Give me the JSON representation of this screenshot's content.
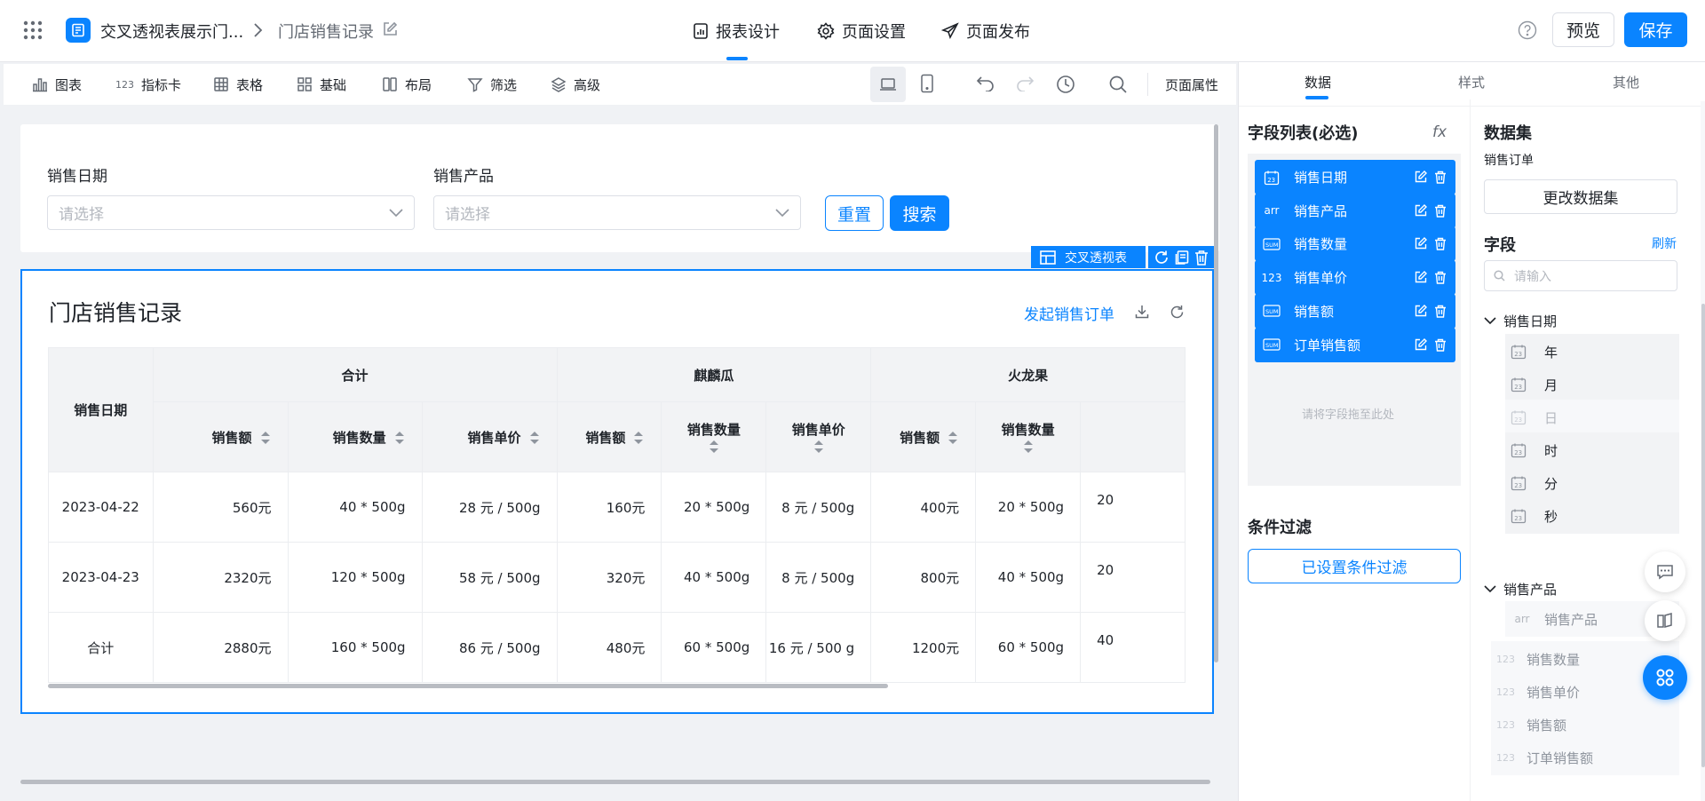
{
  "header": {
    "app_title": "交叉透视表展示门...",
    "page_name": "门店销售记录",
    "tabs": [
      {
        "label": "报表设计",
        "icon": "report-design-icon",
        "active": true
      },
      {
        "label": "页面设置",
        "icon": "gear-icon",
        "active": false
      },
      {
        "label": "页面发布",
        "icon": "send-icon",
        "active": false
      }
    ],
    "preview_label": "预览",
    "save_label": "保存"
  },
  "toolbar": {
    "items": [
      "图表",
      "指标卡",
      "表格",
      "基础",
      "布局",
      "筛选",
      "高级"
    ],
    "page_props_label": "页面属性",
    "count_icon_text": "123"
  },
  "filter": {
    "date_label": "销售日期",
    "date_placeholder": "请选择",
    "product_label": "销售产品",
    "product_placeholder": "请选择",
    "reset_label": "重置",
    "search_label": "搜索"
  },
  "widget_tag": {
    "label": "交叉透视表"
  },
  "report": {
    "title": "门店销售记录",
    "action_link": "发起销售订单",
    "row_header": "销售日期",
    "groups": [
      "合计",
      "麒麟瓜",
      "火龙果"
    ],
    "columns": [
      "销售额",
      "销售数量",
      "销售单价",
      "销售额",
      "销售数量",
      "销售单价",
      "销售额",
      "销售数量"
    ],
    "rows": [
      {
        "date": "2023-04-22",
        "cells": [
          "560元",
          "40 * 500g",
          "28 元 / 500g",
          "160元",
          "20 * 500g",
          "8 元 / 500g",
          "400元",
          "20 * 500g"
        ],
        "cut": "20"
      },
      {
        "date": "2023-04-23",
        "cells": [
          "2320元",
          "120 * 500g",
          "58 元 / 500g",
          "320元",
          "40 * 500g",
          "8 元 / 500g",
          "800元",
          "40 * 500g"
        ],
        "cut": "20"
      },
      {
        "date": "合计",
        "cells": [
          "2880元",
          "160 * 500g",
          "86 元 / 500g",
          "480元",
          "60 * 500g",
          "16 元 / 500 g",
          "1200元",
          "60 * 500g"
        ],
        "cut": "40"
      }
    ]
  },
  "panel": {
    "tabs": [
      "数据",
      "样式",
      "其他"
    ],
    "field_list_title": "字段列表(必选)",
    "fx_label": "fx",
    "fields": [
      {
        "icon_text": "date",
        "label": "销售日期"
      },
      {
        "icon_text": "arr",
        "label": "销售产品"
      },
      {
        "icon_text": "sum",
        "label": "销售数量"
      },
      {
        "icon_text": "123",
        "label": "销售单价"
      },
      {
        "icon_text": "sum",
        "label": "销售额"
      },
      {
        "icon_text": "sum",
        "label": "订单销售额"
      }
    ],
    "drop_hint": "请将字段拖至此处",
    "condition_title": "条件过滤",
    "condition_button": "已设置条件过滤",
    "dataset_title": "数据集",
    "dataset_name": "销售订单",
    "change_dataset_label": "更改数据集",
    "fields_title": "字段",
    "refresh_label": "刷新",
    "search_placeholder": "请输入",
    "tree_date_group": "销售日期",
    "date_parts": [
      "年",
      "月",
      "日",
      "时",
      "分",
      "秒"
    ],
    "tree_product_group": "销售产品",
    "product_item": {
      "icon_text": "arr",
      "label": "销售产品"
    },
    "numeric_items": [
      {
        "icon_text": "123",
        "label": "销售数量"
      },
      {
        "icon_text": "123",
        "label": "销售单价"
      },
      {
        "icon_text": "123",
        "label": "销售额"
      },
      {
        "icon_text": "123",
        "label": "订单销售额"
      }
    ]
  },
  "colors": {
    "accent": "#0a84ff",
    "bg": "#f0f2f5",
    "header_bg": "#f2f3f5"
  }
}
